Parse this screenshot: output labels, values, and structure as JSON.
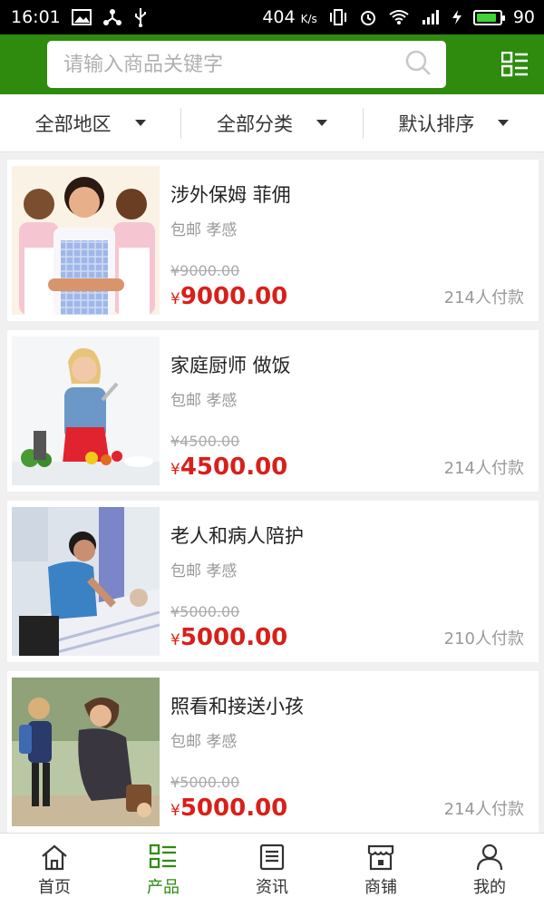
{
  "statusbar": {
    "time": "16:01",
    "speed": "404",
    "speed_unit": "K/s",
    "battery": "90",
    "battery_level": 0.9
  },
  "search": {
    "placeholder": "请输入商品关键字"
  },
  "filters": [
    {
      "label": "全部地区"
    },
    {
      "label": "全部分类"
    },
    {
      "label": "默认排序"
    }
  ],
  "products": [
    {
      "title": "涉外保姆 菲佣",
      "sub": "包邮 孝感",
      "old_price": "¥9000.00",
      "currency": "¥",
      "price": "9000.00",
      "sales": "214人付款"
    },
    {
      "title": "家庭厨师 做饭",
      "sub": "包邮 孝感",
      "old_price": "¥4500.00",
      "currency": "¥",
      "price": "4500.00",
      "sales": "214人付款"
    },
    {
      "title": "老人和病人陪护",
      "sub": "包邮 孝感",
      "old_price": "¥5000.00",
      "currency": "¥",
      "price": "5000.00",
      "sales": "210人付款"
    },
    {
      "title": "照看和接送小孩",
      "sub": "包邮 孝感",
      "old_price": "¥5000.00",
      "currency": "¥",
      "price": "5000.00",
      "sales": "214人付款"
    }
  ],
  "nav": [
    {
      "label": "首页",
      "icon": "home-icon",
      "active": false
    },
    {
      "label": "产品",
      "icon": "list-icon",
      "active": true
    },
    {
      "label": "资讯",
      "icon": "news-icon",
      "active": false
    },
    {
      "label": "商铺",
      "icon": "store-icon",
      "active": false
    },
    {
      "label": "我的",
      "icon": "user-icon",
      "active": false
    }
  ],
  "colors": {
    "brand_green": "#2e8b0e",
    "price_red": "#d8201a"
  }
}
